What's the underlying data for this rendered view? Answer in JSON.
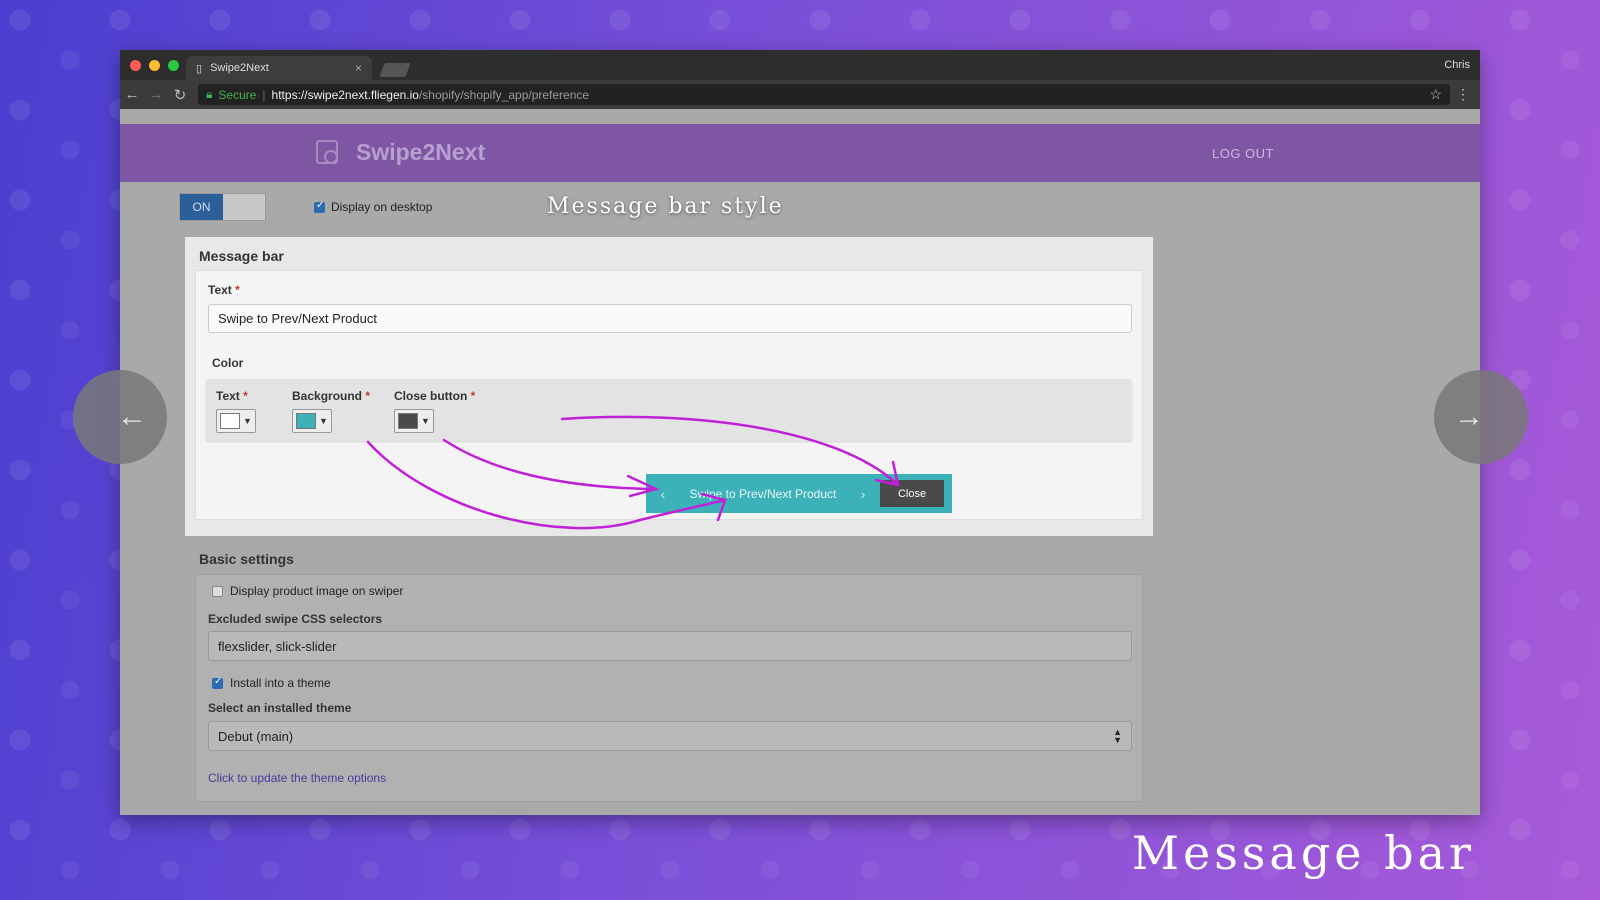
{
  "browser": {
    "tab_title": "Swipe2Next",
    "tab_close": "×",
    "profile": "Chris",
    "back": "←",
    "forward": "→",
    "reload": "↻",
    "secure_label": "Secure",
    "url_scheme_host": "https://swipe2next.fliegen.io",
    "url_path": "/shopify/shopify_app/preference",
    "star": "☆",
    "menu": "⋮"
  },
  "header": {
    "brand": "Swipe2Next",
    "logout": "LOG OUT"
  },
  "toolbar": {
    "toggle_on": "ON",
    "display_desktop": "Display on desktop"
  },
  "overlay": {
    "section_caption": "Message bar style",
    "slide_caption": "Message bar"
  },
  "message_bar": {
    "title": "Message bar",
    "text_label": "Text",
    "required": "*",
    "text_value": "Swipe to Prev/Next Product",
    "color_label": "Color",
    "color_text_label": "Text",
    "color_bg_label": "Background",
    "color_close_label": "Close button",
    "colors": {
      "text": "#ffffff",
      "background": "#3db1b8",
      "close_button": "#4a4a4a"
    },
    "preview": {
      "prev": "‹",
      "text": "Swipe to Prev/Next Product",
      "next": "›",
      "close": "Close"
    }
  },
  "basic": {
    "title": "Basic settings",
    "display_image_label": "Display product image on swiper",
    "excluded_label": "Excluded swipe CSS selectors",
    "excluded_value": "flexslider, slick-slider",
    "install_label": "Install into a theme",
    "select_label": "Select an installed theme",
    "select_value": "Debut (main)",
    "update_link": "Click to update the theme options"
  },
  "nav": {
    "left_arrow": "←",
    "right_arrow": "→"
  },
  "accent_colors": {
    "header": "#7f56a4",
    "annotation_arrow": "#c020d8",
    "toggle_on": "#2b5f99"
  }
}
